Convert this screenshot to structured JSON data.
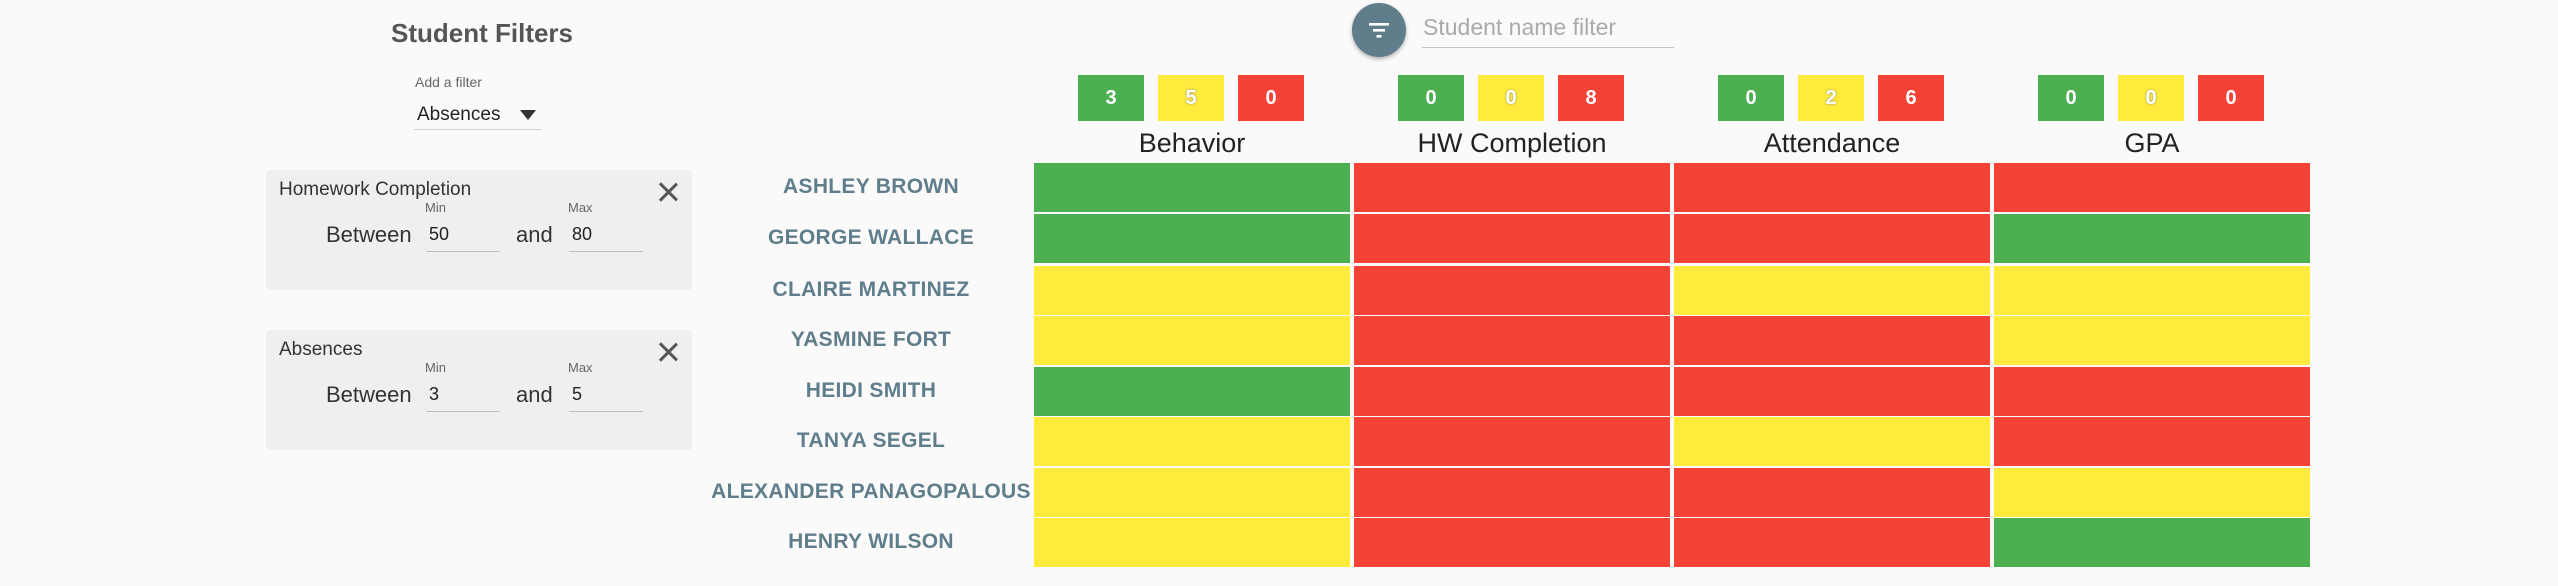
{
  "sidebar": {
    "title": "Student Filters",
    "add_filter_label": "Add a filter",
    "add_filter_selected": "Absences",
    "filters": [
      {
        "title": "Homework Completion",
        "between": "Between",
        "and": "and",
        "min_label": "Min",
        "min_value": "50",
        "max_label": "Max",
        "max_value": "80"
      },
      {
        "title": "Absences",
        "between": "Between",
        "and": "and",
        "min_label": "Min",
        "min_value": "3",
        "max_label": "Max",
        "max_value": "5"
      }
    ]
  },
  "search": {
    "placeholder": "Student name filter",
    "icon": "filter-list-icon"
  },
  "colors": {
    "green": "#4caf50",
    "yellow": "#ffeb3b",
    "red": "#f44336",
    "accent": "#607d8b"
  },
  "columns": [
    {
      "title": "Behavior",
      "counts": {
        "green": "3",
        "yellow": "5",
        "red": "0"
      }
    },
    {
      "title": "HW Completion",
      "counts": {
        "green": "0",
        "yellow": "0",
        "red": "8"
      }
    },
    {
      "title": "Attendance",
      "counts": {
        "green": "0",
        "yellow": "2",
        "red": "6"
      }
    },
    {
      "title": "GPA",
      "counts": {
        "green": "0",
        "yellow": "0",
        "red": "0"
      }
    }
  ],
  "students": [
    {
      "name": "ASHLEY BROWN",
      "statuses": [
        "green",
        "red",
        "red",
        "red"
      ]
    },
    {
      "name": "GEORGE WALLACE",
      "statuses": [
        "green",
        "red",
        "red",
        "green"
      ]
    },
    {
      "name": "CLAIRE MARTINEZ",
      "statuses": [
        "yellow",
        "red",
        "yellow",
        "yellow"
      ]
    },
    {
      "name": "YASMINE FORT",
      "statuses": [
        "yellow",
        "red",
        "red",
        "yellow"
      ]
    },
    {
      "name": "HEIDI SMITH",
      "statuses": [
        "green",
        "red",
        "red",
        "red"
      ]
    },
    {
      "name": "TANYA SEGEL",
      "statuses": [
        "yellow",
        "red",
        "yellow",
        "red"
      ]
    },
    {
      "name": "ALEXANDER PANAGOPALOUS",
      "statuses": [
        "yellow",
        "red",
        "red",
        "yellow"
      ]
    },
    {
      "name": "HENRY WILSON",
      "statuses": [
        "yellow",
        "red",
        "red",
        "green"
      ]
    }
  ]
}
